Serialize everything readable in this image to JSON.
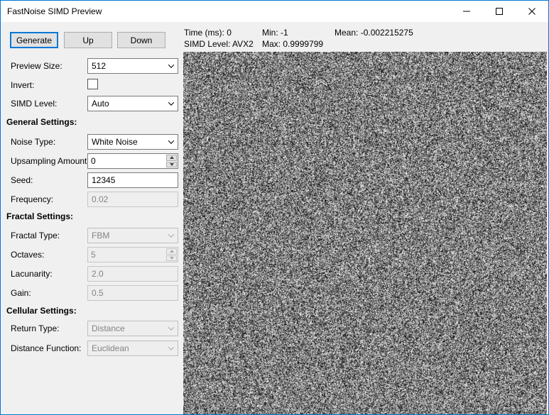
{
  "window": {
    "title": "FastNoise SIMD Preview"
  },
  "colors": {
    "accent": "#0078d7",
    "titlebar_bg": "#ffffff",
    "window_bg": "#f0f0f0"
  },
  "toolbar": {
    "generate": "Generate",
    "up": "Up",
    "down": "Down"
  },
  "status": {
    "time": {
      "label": "Time (ms):",
      "value": "0"
    },
    "simd_level": {
      "label": "SIMD Level:",
      "value": "AVX2"
    },
    "min": {
      "label": "Min:",
      "value": "-1"
    },
    "max": {
      "label": "Max:",
      "value": "0.9999799"
    },
    "mean": {
      "label": "Mean:",
      "value": "-0.002215275"
    }
  },
  "headings": {
    "general": "General Settings:",
    "fractal": "Fractal Settings:",
    "cellular": "Cellular Settings:"
  },
  "fields": {
    "preview_size": {
      "label": "Preview Size:",
      "value": "512",
      "enabled": true
    },
    "invert": {
      "label": "Invert:",
      "checked": false,
      "enabled": true
    },
    "simd_level": {
      "label": "SIMD Level:",
      "value": "Auto",
      "enabled": true
    },
    "noise_type": {
      "label": "Noise Type:",
      "value": "White Noise",
      "enabled": true
    },
    "upsampling_amount": {
      "label": "Upsampling Amount:",
      "value": "0",
      "enabled": true
    },
    "seed": {
      "label": "Seed:",
      "value": "12345",
      "enabled": true
    },
    "frequency": {
      "label": "Frequency:",
      "value": "0.02",
      "enabled": false
    },
    "fractal_type": {
      "label": "Fractal Type:",
      "value": "FBM",
      "enabled": false
    },
    "octaves": {
      "label": "Octaves:",
      "value": "5",
      "enabled": false
    },
    "lacunarity": {
      "label": "Lacunarity:",
      "value": "2.0",
      "enabled": false
    },
    "gain": {
      "label": "Gain:",
      "value": "0.5",
      "enabled": false
    },
    "return_type": {
      "label": "Return Type:",
      "value": "Distance",
      "enabled": false
    },
    "distance_function": {
      "label": "Distance Function:",
      "value": "Euclidean",
      "enabled": false
    }
  }
}
